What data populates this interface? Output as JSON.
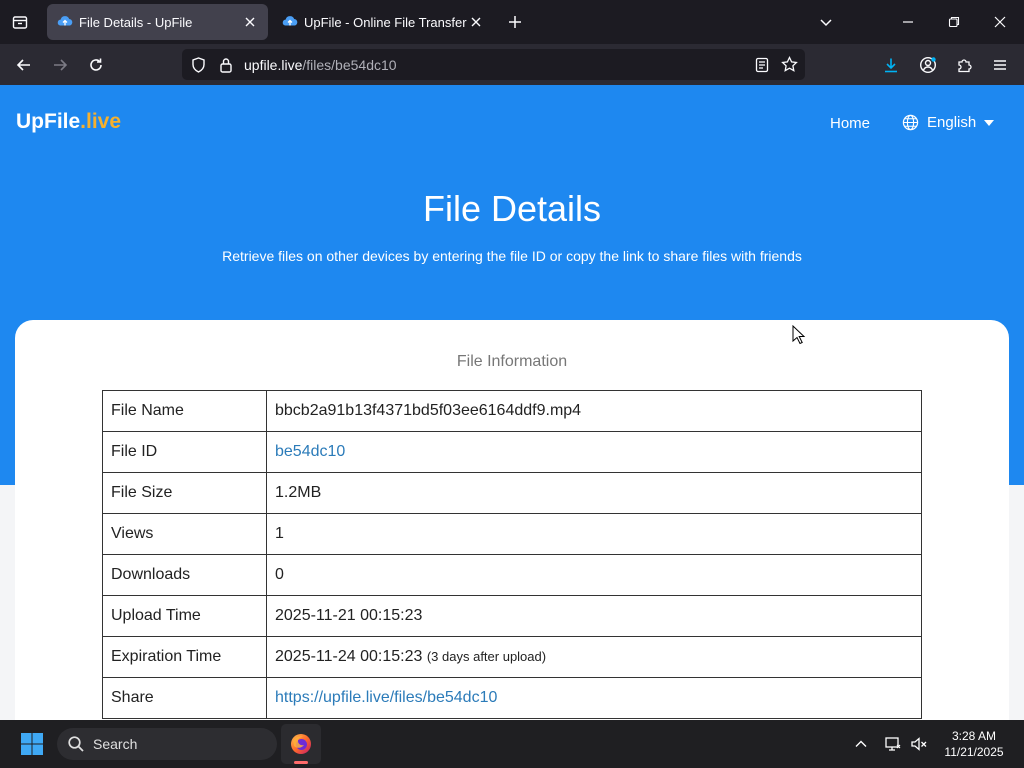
{
  "browser": {
    "tabs": [
      {
        "title": "File Details - UpFile",
        "active": true
      },
      {
        "title": "UpFile - Online File Transfer",
        "active": false
      }
    ],
    "url": {
      "host": "upfile.live",
      "path": "/files/be54dc10"
    }
  },
  "site": {
    "logo": {
      "main": "UpFile",
      "accent": ".live"
    },
    "nav": {
      "home": "Home",
      "language": "English"
    },
    "hero": {
      "title": "File Details",
      "subtitle": "Retrieve files on other devices by entering the file ID or copy the link to share files with friends"
    },
    "card": {
      "title": "File Information",
      "rows": [
        {
          "label": "File Name",
          "value": "bbcb2a91b13f4371bd5f03ee6164ddf9.mp4",
          "type": "text"
        },
        {
          "label": "File ID",
          "value": "be54dc10",
          "type": "link"
        },
        {
          "label": "File Size",
          "value": "1.2MB",
          "type": "text"
        },
        {
          "label": "Views",
          "value": "1",
          "type": "text"
        },
        {
          "label": "Downloads",
          "value": "0",
          "type": "text"
        },
        {
          "label": "Upload Time",
          "value": "2025-11-21 00:15:23",
          "type": "text"
        },
        {
          "label": "Expiration Time",
          "value": "2025-11-24 00:15:23",
          "note": "(3 days after upload)",
          "type": "text"
        },
        {
          "label": "Share",
          "value": "https://upfile.live/files/be54dc10",
          "type": "link"
        }
      ]
    }
  },
  "taskbar": {
    "search_placeholder": "Search",
    "time": "3:28 AM",
    "date": "11/21/2025"
  },
  "colors": {
    "brand_blue": "#1e88f0",
    "logo_accent": "#f5b02e",
    "link": "#2b7bb9"
  }
}
